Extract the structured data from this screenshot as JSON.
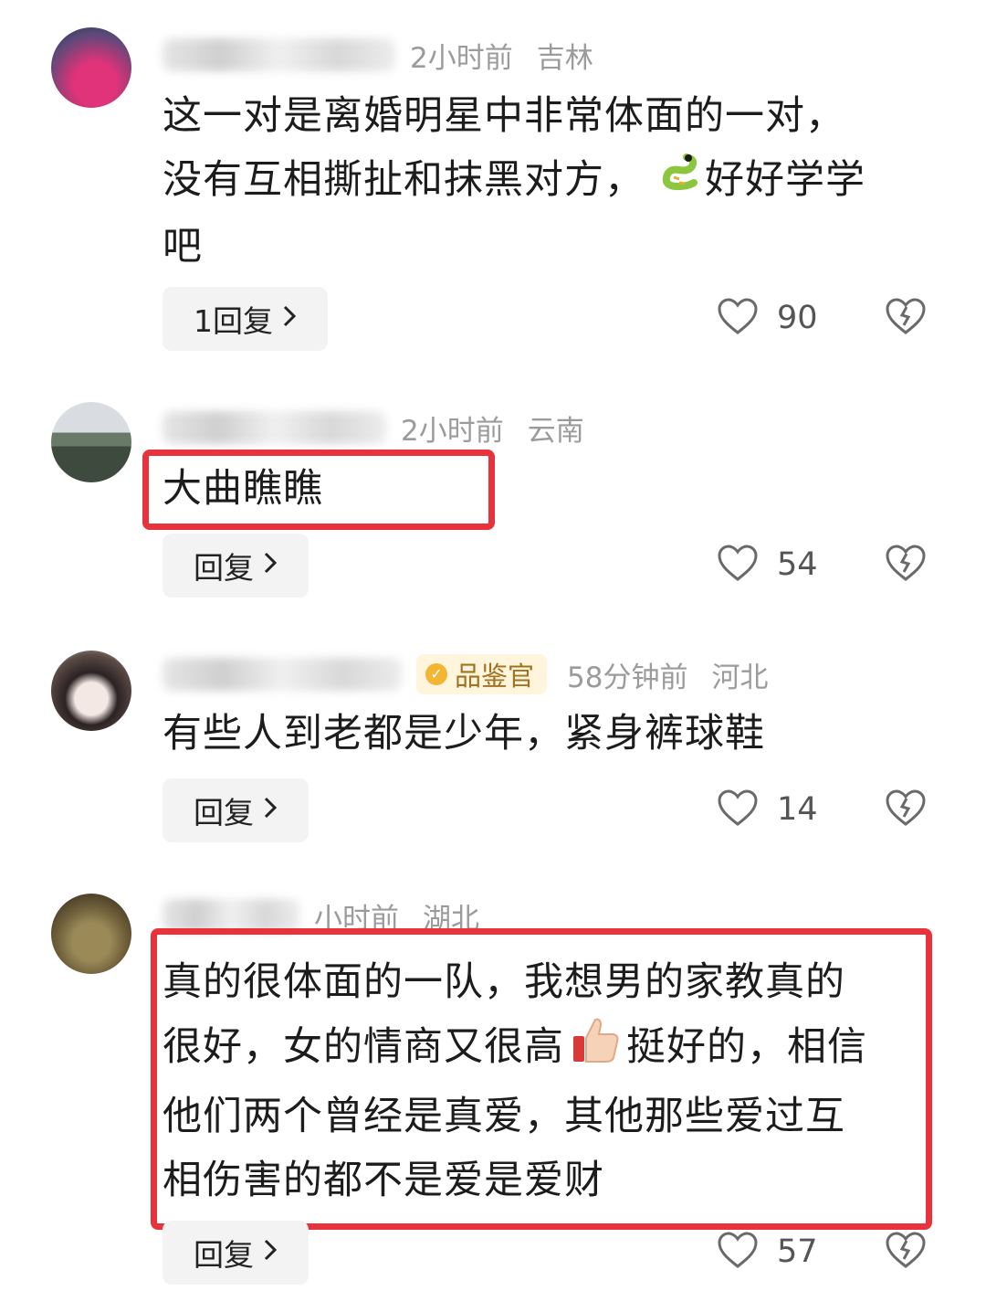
{
  "comments": [
    {
      "time": "2小时前",
      "location": "吉林",
      "text_lines": [
        "这一对是离婚明星中非常体面的一对，",
        "没有互相撕扯和抹黑对方，",
        "好好学学",
        "吧"
      ],
      "reply_label": "1回复",
      "likes": "90"
    },
    {
      "time": "2小时前",
      "location": "云南",
      "text": "大曲瞧瞧",
      "reply_label": "回复",
      "likes": "54"
    },
    {
      "badge": "品鉴官",
      "time": "58分钟前",
      "location": "河北",
      "text": "有些人到老都是少年，紧身裤球鞋",
      "reply_label": "回复",
      "likes": "14"
    },
    {
      "time": "小时前",
      "location": "湖北",
      "text_lines": [
        "真的很体面的一队，我想男的家教真的",
        "很好，女的情商又很高",
        "挺好的，相信",
        "他们两个曾经是真爱，其他那些爱过互",
        "相伤害的都不是爱是爱财"
      ],
      "reply_label": "回复",
      "likes": "57"
    }
  ],
  "icons": {
    "like": "heart-outline-icon",
    "dislike": "broken-heart-icon",
    "chevron": "chevron-right-icon",
    "snake_emoji": "snake-emoji",
    "thumbs_up_emoji": "thumbs-up-emoji"
  },
  "colors": {
    "highlight": "#e8333c",
    "meta_text": "#9b9b9b",
    "badge_bg": "#fff4dc",
    "badge_text": "#a07320"
  }
}
